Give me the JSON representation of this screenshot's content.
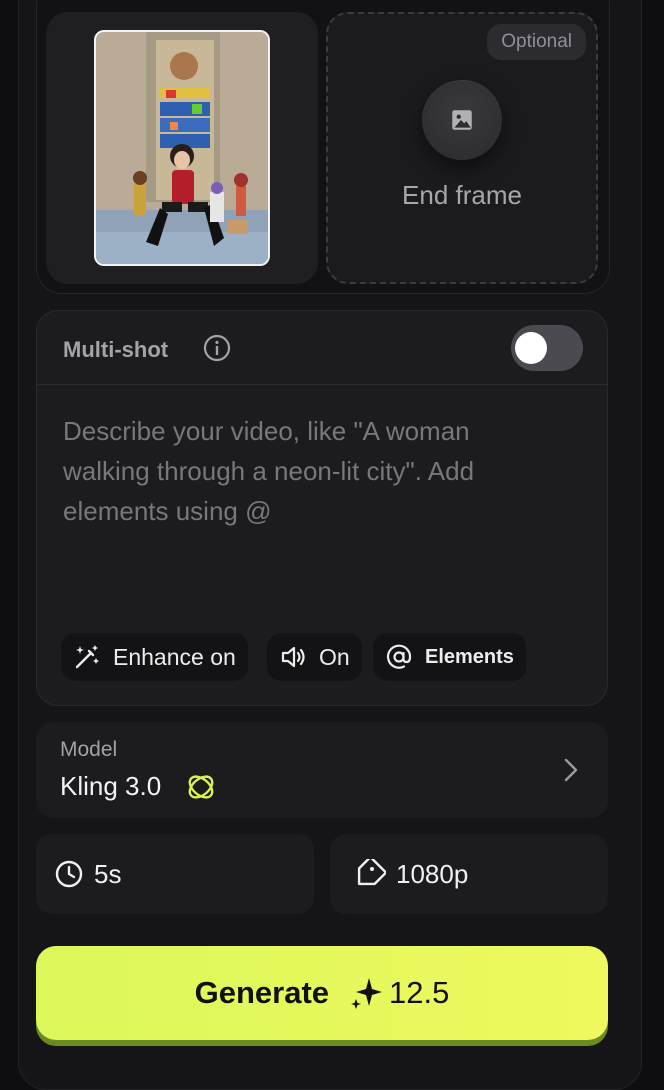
{
  "frames": {
    "optional_badge": "Optional",
    "end_frame_label": "End frame",
    "start_frame_icon": "image-thumbnail",
    "end_frame_icon": "image-icon"
  },
  "prompt": {
    "multishot_label": "Multi-shot",
    "multishot_enabled": false,
    "placeholder": "Describe your video, like \"A woman walking through a neon-lit city\". Add elements using @",
    "chips": [
      {
        "label": "Enhance on",
        "icon": "magic-wand-icon"
      },
      {
        "label": "On",
        "icon": "speaker-icon"
      },
      {
        "label": "Elements",
        "icon": "at-icon"
      }
    ]
  },
  "model": {
    "label": "Model",
    "name": "Kling 3.0"
  },
  "settings": {
    "duration": "5s",
    "resolution": "1080p"
  },
  "generate": {
    "label": "Generate",
    "cost": "12.5"
  },
  "colors": {
    "accent": "#e4f85c",
    "background": "#151517"
  }
}
